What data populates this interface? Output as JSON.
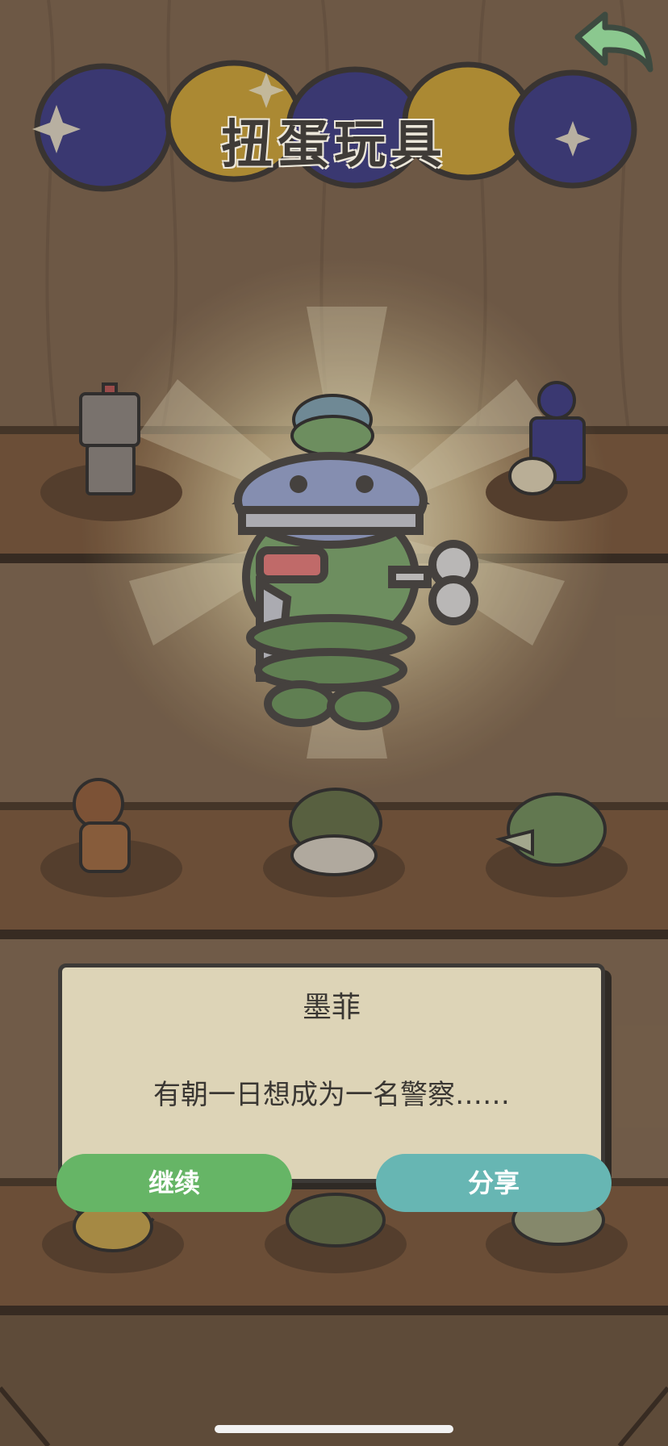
{
  "header": {
    "title": "扭蛋玩具",
    "back_icon": "back-arrow-icon"
  },
  "featured_toy": {
    "icon": "wind-up-robot-icon"
  },
  "shelf_items": [
    {
      "icon": "tin-robot-icon"
    },
    {
      "icon": "green-dome-robot-icon"
    },
    {
      "icon": "drummer-robot-icon"
    },
    {
      "icon": "brown-robot-icon"
    },
    {
      "icon": "turtle-toy-icon"
    },
    {
      "icon": "crocodile-toy-icon"
    },
    {
      "icon": "seal-toy-icon"
    },
    {
      "icon": "lizard-toy-icon"
    },
    {
      "icon": "frog-toy-icon"
    }
  ],
  "dialog": {
    "name": "墨菲",
    "description": "有朝一日想成为一名警察……"
  },
  "buttons": {
    "continue_label": "继续",
    "share_label": "分享"
  },
  "colors": {
    "continue": "#66b566",
    "share": "#67b6b3",
    "dialog_bg": "#ddd4b7"
  }
}
